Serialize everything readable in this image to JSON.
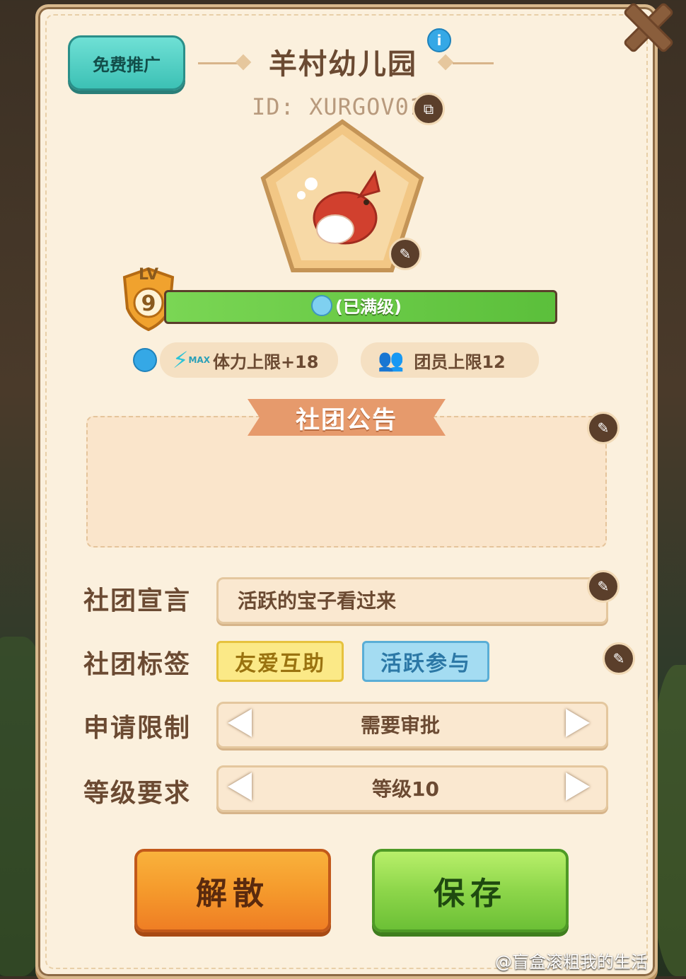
{
  "header": {
    "promo_label": "免费推广",
    "title": "羊村幼儿园",
    "id_text": "ID: XURGOV01"
  },
  "level": {
    "lv_prefix": "LV",
    "lv_number": "9",
    "status_text": "(已满级)",
    "progress": 1.0
  },
  "perks": {
    "stamina": "体力上限+18",
    "members": "团员上限12",
    "max_badge": "MAX"
  },
  "notice": {
    "header": "社团公告",
    "content": ""
  },
  "form": {
    "declaration_label": "社团宣言",
    "declaration_value": "活跃的宝子看过来",
    "tags_label": "社团标签",
    "tags": [
      "友爱互助",
      "活跃参与"
    ],
    "apply_label": "申请限制",
    "apply_value": "需要审批",
    "level_label": "等级要求",
    "level_value": "等级10"
  },
  "actions": {
    "disband": "解散",
    "save": "保存"
  },
  "watermark": "@盲盒滚粗我的生活",
  "colors": {
    "panel": "#fbf0dd",
    "accent_teal": "#3cc1b5",
    "accent_green": "#5bbf3b",
    "accent_orange": "#f08a2a",
    "text_brown": "#6b4a32"
  }
}
